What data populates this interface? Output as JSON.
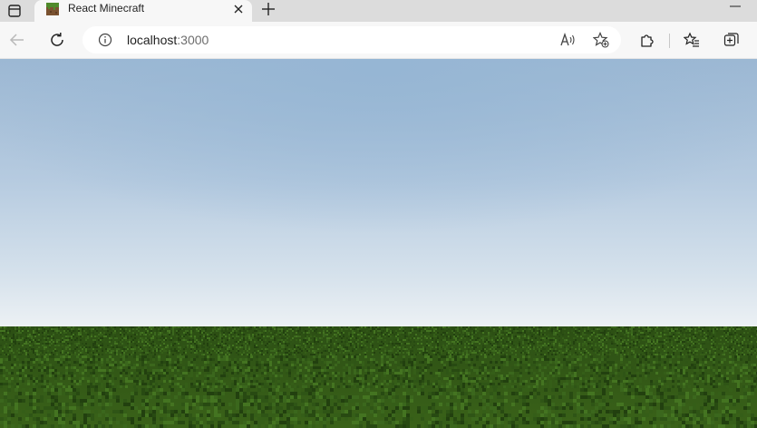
{
  "browser": {
    "tab": {
      "title": "React Minecraft",
      "favicon": "grass-block-icon"
    },
    "address_bar": {
      "host": "localhost",
      "port": ":3000"
    },
    "icons": {
      "tab_actions": "tab-actions-icon",
      "close": "close-icon",
      "new_tab": "plus-icon",
      "minimize": "minimize-icon",
      "back": "back-arrow-icon",
      "refresh": "refresh-icon",
      "site_info": "info-icon",
      "read_aloud": "read-aloud-icon",
      "add_favorite": "add-favorite-icon",
      "extensions": "puzzle-icon",
      "favorites": "favorites-icon",
      "collections": "collections-icon"
    }
  },
  "scene": {
    "sky_top": "#9db8d3",
    "sky_horizon": "#eef2f5",
    "grass": "#2d4f15",
    "grass_highlight": "#3d6a1c"
  }
}
